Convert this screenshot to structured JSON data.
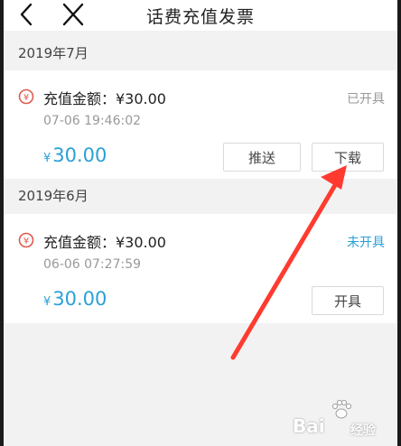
{
  "nav": {
    "title": "话费充值发票",
    "back_icon": "chevron-left-icon",
    "close_icon": "close-icon"
  },
  "months": [
    {
      "header": "2019年7月",
      "invoice": {
        "amount_label": "充值金额：¥30.00",
        "time": "07-06 19:46:02",
        "status": "已开具",
        "price_symbol": "¥",
        "price": "30.00",
        "buttons": [
          "推送",
          "下载"
        ]
      }
    },
    {
      "header": "2019年6月",
      "invoice": {
        "amount_label": "充值金额：¥30.00",
        "time": "06-06 07:27:59",
        "status": "未开具",
        "price_symbol": "¥",
        "price": "30.00",
        "buttons": [
          "开具"
        ]
      }
    }
  ],
  "watermark": {
    "text_en": "Bai",
    "text_cn": "经验",
    "logo_icon": "baidu-paw-icon"
  },
  "colors": {
    "accent": "#2aa0d8",
    "status_done": "#999999",
    "arrow": "#ff3b30",
    "coin": "#e05a4e"
  }
}
